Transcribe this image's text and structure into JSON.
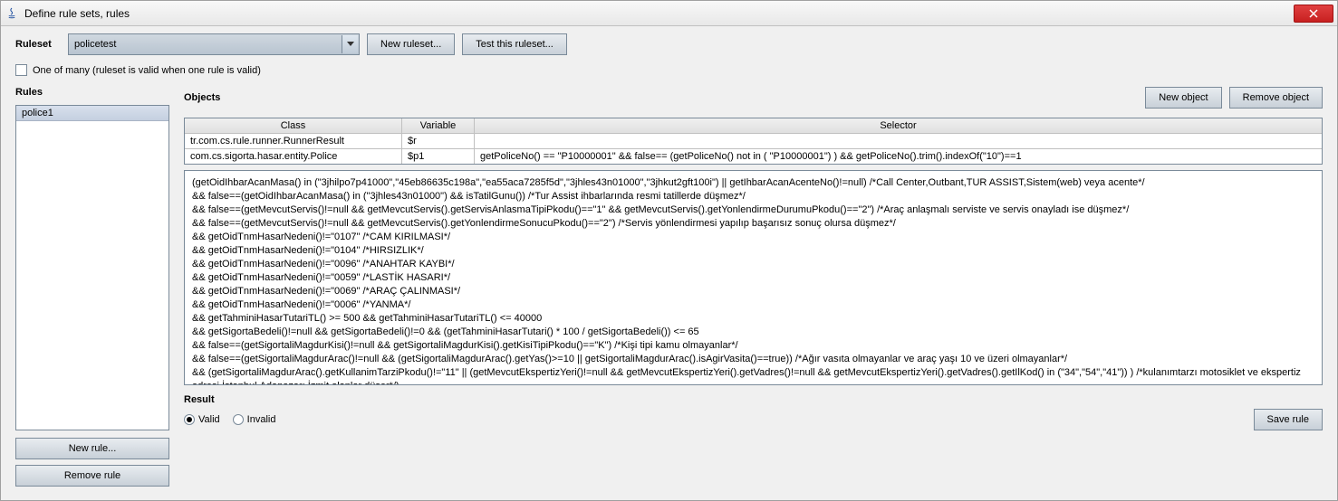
{
  "window": {
    "title": "Define rule sets, rules"
  },
  "ruleset_section": {
    "label": "Ruleset",
    "selected": "policetest",
    "new_button": "New ruleset...",
    "test_button": "Test this ruleset...",
    "one_of_many_label": "One of many (ruleset is valid when one rule is valid)"
  },
  "rules": {
    "label": "Rules",
    "items": [
      "police1"
    ],
    "new_button": "New rule...",
    "remove_button": "Remove rule"
  },
  "objects": {
    "label": "Objects",
    "new_button": "New object",
    "remove_button": "Remove object",
    "headers": {
      "class": "Class",
      "variable": "Variable",
      "selector": "Selector"
    },
    "rows": [
      {
        "class": "tr.com.cs.rule.runner.RunnerResult",
        "variable": "$r",
        "selector": ""
      },
      {
        "class": "com.cs.sigorta.hasar.entity.Police",
        "variable": "$p1",
        "selector": "getPoliceNo() == \"P10000001\" && false== (getPoliceNo()  not in ( \"P10000001\") ) && getPoliceNo().trim().indexOf(\"10\")==1"
      }
    ],
    "detail": "(getOidIhbarAcanMasa() in (\"3jhilpo7p41000\",\"45eb86635c198a\",\"ea55aca7285f5d\",\"3jhles43n01000\",\"3jhkut2gft100i\") || getIhbarAcanAcenteNo()!=null) /*Call Center,Outbant,TUR ASSIST,Sistem(web) veya acente*/\n&& false==(getOidIhbarAcanMasa() in (\"3jhles43n01000\") && isTatilGunu()) /*Tur Assist ihbarlarında resmi tatillerde düşmez*/\n&& false==(getMevcutServis()!=null && getMevcutServis().getServisAnlasmaTipiPkodu()==\"1\" && getMevcutServis().getYonlendirmeDurumuPkodu()==\"2\") /*Araç anlaşmalı serviste ve servis onayladı ise düşmez*/\n&& false==(getMevcutServis()!=null && getMevcutServis().getYonlendirmeSonucuPkodu()==\"2\") /*Servis yönlendirmesi yapılıp başarısız sonuç olursa düşmez*/\n&& getOidTnmHasarNedeni()!=\"0107\" /*CAM KIRILMASI*/\n&& getOidTnmHasarNedeni()!=\"0104\" /*HIRSIZLIK*/\n&& getOidTnmHasarNedeni()!=\"0096\" /*ANAHTAR KAYBI*/\n&& getOidTnmHasarNedeni()!=\"0059\" /*LASTİK HASARI*/\n&& getOidTnmHasarNedeni()!=\"0069\" /*ARAÇ ÇALINMASI*/\n&& getOidTnmHasarNedeni()!=\"0006\" /*YANMA*/\n&& getTahminiHasarTutariTL() >= 500 && getTahminiHasarTutariTL() <= 40000\n&& getSigortaBedeli()!=null && getSigortaBedeli()!=0 && (getTahminiHasarTutari() * 100 / getSigortaBedeli()) <= 65\n&& false==(getSigortaliMagdurKisi()!=null && getSigortaliMagdurKisi().getKisiTipiPkodu()==\"K\") /*Kişi tipi kamu olmayanlar*/\n&& false==(getSigortaliMagdurArac()!=null && (getSigortaliMagdurArac().getYas()>=10 || getSigortaliMagdurArac().isAgirVasita()==true)) /*Ağır vasıta olmayanlar ve araç yaşı 10 ve üzeri olmayanlar*/\n&& (getSigortaliMagdurArac().getKullanimTarziPkodu()!=\"11\" || (getMevcutEkspertizYeri()!=null && getMevcutEkspertizYeri().getVadres()!=null && getMevcutEkspertizYeri().getVadres().getIlKod() in (\"34\",\"54\",\"41\")) ) /*kulanımtarzı motosiklet ve ekspertiz adresi İstanbul,Adapazarı,İzmit olanlar düşer*/)"
  },
  "result": {
    "label": "Result",
    "valid": "Valid",
    "invalid": "Invalid",
    "save_button": "Save rule"
  }
}
